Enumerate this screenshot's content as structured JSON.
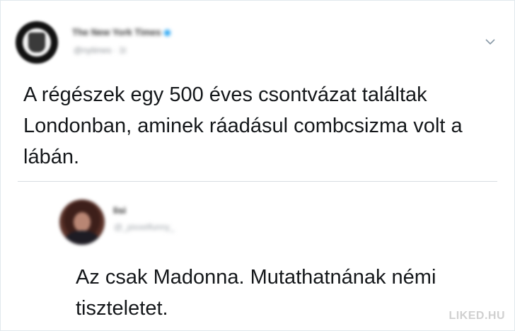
{
  "main_tweet": {
    "author_name": "The New York Times",
    "author_handle": "@nytimes · 1t",
    "text": "A régészek egy 500 éves csontvázat találtak Londonban, aminek ráadásul combcsizma volt a lábán.",
    "menu_icon": "chevron-down-icon"
  },
  "reply": {
    "author_name": "lisi",
    "author_handle": "@_pixxelfunny_",
    "text": "Az csak Madonna. Mutathatnának némi tiszteletet."
  },
  "watermark": "LIKED.HU",
  "colors": {
    "text": "#14171a",
    "muted": "#8a8f94",
    "divider": "#d7dde2",
    "verified": "#1da1f2"
  }
}
